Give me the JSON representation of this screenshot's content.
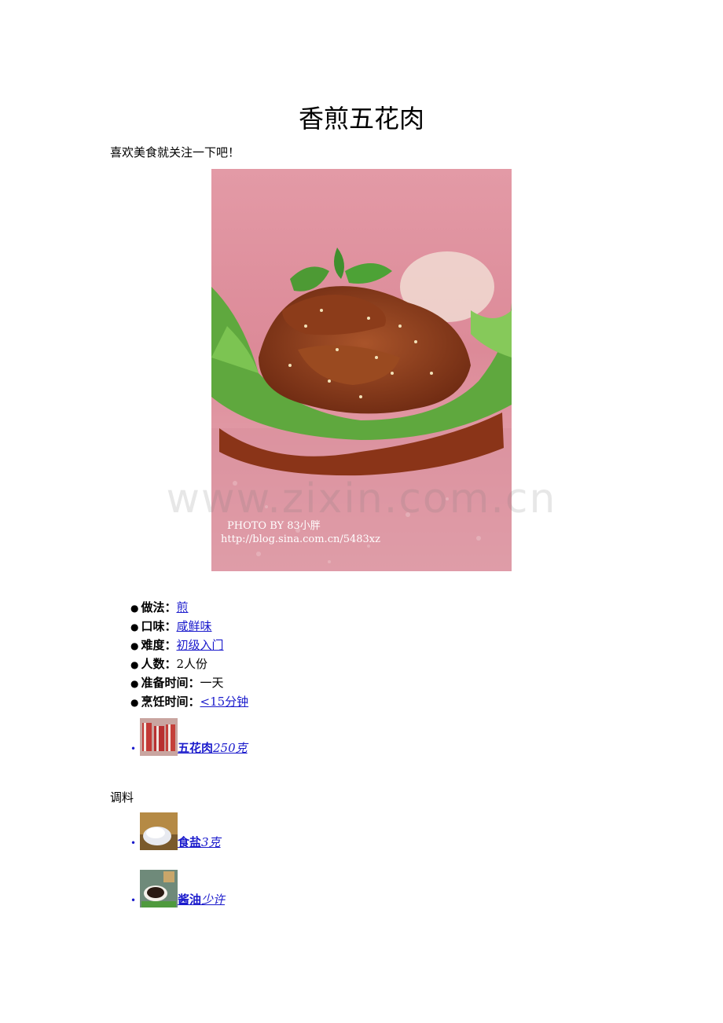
{
  "title": "香煎五花肉",
  "intro": "喜欢美食就关注一下吧！",
  "photo": {
    "caption_line1": "PHOTO BY 83小胖",
    "caption_line2": "http://blog.sina.com.cn/5483xz",
    "watermark": "www.zixin.com.cn"
  },
  "meta": [
    {
      "key": "做法：",
      "value": "煎",
      "link": true
    },
    {
      "key": "口味：",
      "value": "咸鲜味",
      "link": true
    },
    {
      "key": "难度：",
      "value": "初级入门",
      "link": true
    },
    {
      "key": "人数：",
      "value": "2人份",
      "link": false
    },
    {
      "key": "准备时间：",
      "value": "一天",
      "link": false
    },
    {
      "key": "烹饪时间：",
      "value": "<15分钟",
      "link": true
    }
  ],
  "main_ingredient": {
    "name": "五花肉",
    "amount": "250克"
  },
  "seasoning_heading": "调料",
  "seasonings": [
    {
      "name": "食盐",
      "amount": "3克"
    },
    {
      "name": "酱油",
      "amount": "少许"
    }
  ],
  "colors": {
    "link": "#1a1acc"
  }
}
